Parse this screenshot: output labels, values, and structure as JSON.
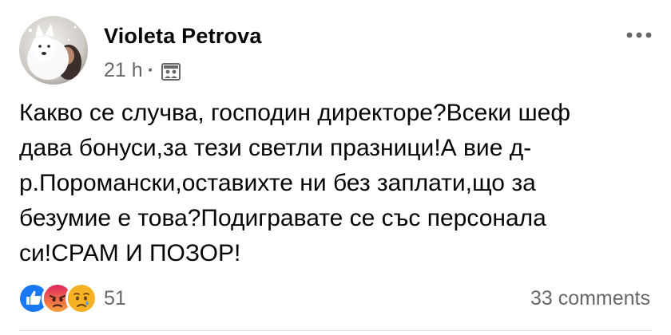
{
  "post": {
    "author": "Violeta Petrova",
    "time": "21 h",
    "separator": "·",
    "audience_icon": "friends-group-icon",
    "more_icon": "more-horizontal-icon",
    "text": "Какво се случва, господин директоре?Всеки шеф\nдава бонуси,за тези светли празници!А вие д-\nр.Поромански,оставихте ни без заплати,що за\nбезумие е това?Подигравате се със персонала\nси!СРАМ И ПОЗОР!",
    "reactions": {
      "icons": [
        "like-icon",
        "angry-icon",
        "sad-icon"
      ],
      "count": "51"
    },
    "comments": "33 comments"
  },
  "colors": {
    "text": "#050505",
    "secondary": "#65676b",
    "like_blue": "#1877f2",
    "angry_orange": "#e9710f",
    "sad_yellow": "#f7b125"
  }
}
